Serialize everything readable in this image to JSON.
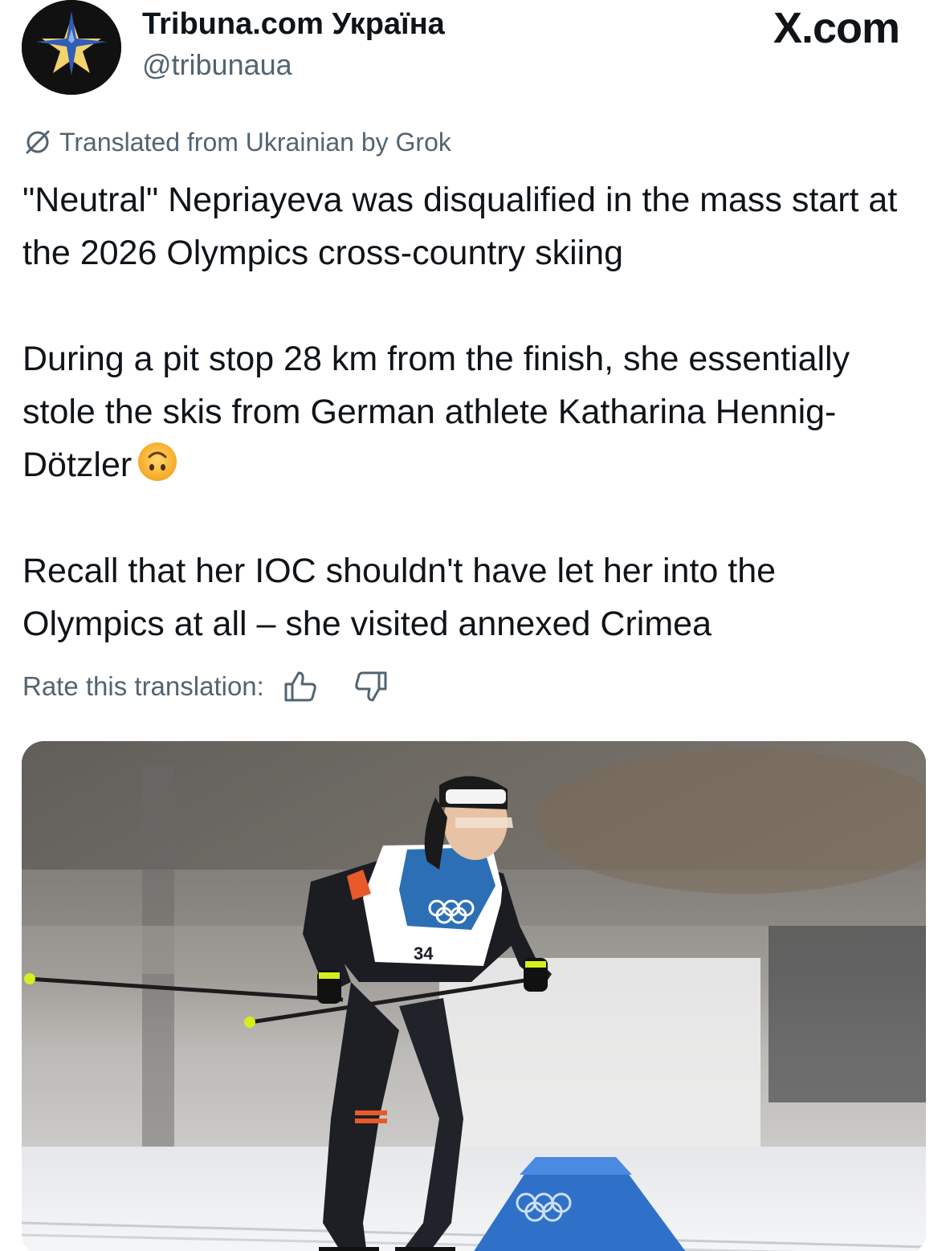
{
  "author": {
    "display_name": "Tribuna.com Україна",
    "handle": "@tribunaua",
    "avatar_icon": "star-logo-icon"
  },
  "source": {
    "label": "X.com"
  },
  "translation": {
    "note": "Translated from Ukrainian by Grok",
    "icon": "translate-icon"
  },
  "tweet": {
    "paragraph_1": "\"Neutral\" Nepriayeva was disqualified in the mass start at the 2026 Olympics cross-country skiing",
    "paragraph_2": "During a pit stop 28 km from the finish, she essentially stole the skis from German athlete Katharina Hennig-Dötzler",
    "paragraph_2_emoji": "upside-down-face-emoji",
    "paragraph_3": "Recall that her IOC shouldn't have let her into the Olympics at all – she visited annexed Crimea"
  },
  "rate": {
    "label": "Rate this translation:",
    "like_icon": "thumbs-up-icon",
    "dislike_icon": "thumbs-down-icon"
  },
  "media": {
    "bib_number": "34"
  },
  "colors": {
    "text_primary": "#0f1419",
    "text_secondary": "#536471",
    "avatar_bg": "#111111",
    "avatar_star_blue": "#2f5db8",
    "avatar_star_gold": "#f3d36b",
    "bib_blue": "#2c6fb5",
    "marker_blue": "#2f71c9"
  }
}
